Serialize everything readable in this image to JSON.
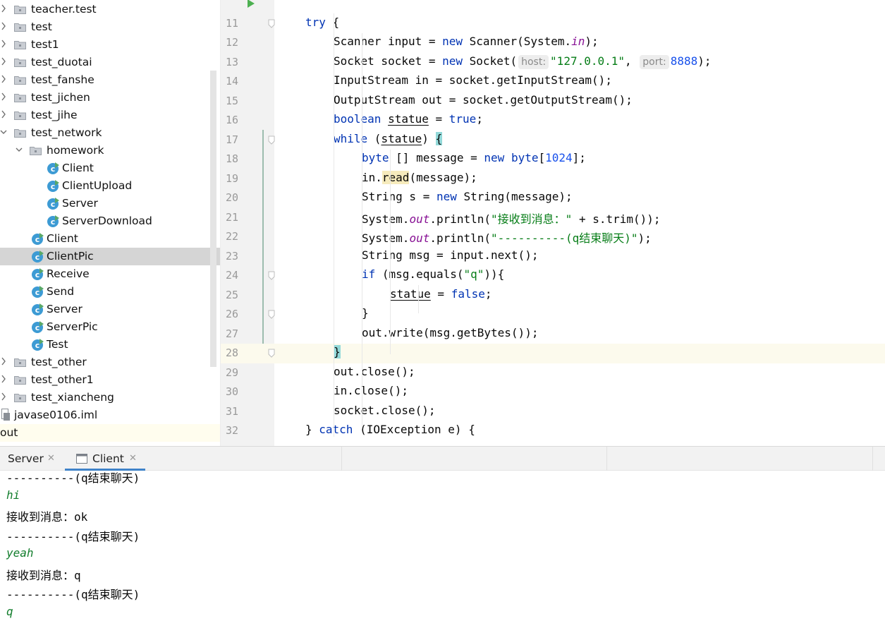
{
  "project_tree": {
    "items": [
      {
        "label": "teacher.test",
        "kind": "folder",
        "arrow": "right"
      },
      {
        "label": "test",
        "kind": "folder",
        "arrow": "right"
      },
      {
        "label": "test1",
        "kind": "folder",
        "arrow": "right"
      },
      {
        "label": "test_duotai",
        "kind": "folder",
        "arrow": "right"
      },
      {
        "label": "test_fanshe",
        "kind": "folder",
        "arrow": "right"
      },
      {
        "label": "test_jichen",
        "kind": "folder",
        "arrow": "right"
      },
      {
        "label": "test_jihe",
        "kind": "folder",
        "arrow": "right"
      },
      {
        "label": "test_network",
        "kind": "folder",
        "arrow": "down"
      },
      {
        "label": "homework",
        "kind": "folder",
        "arrow": "down"
      },
      {
        "label": "Client",
        "kind": "class"
      },
      {
        "label": "ClientUpload",
        "kind": "class"
      },
      {
        "label": "Server",
        "kind": "class"
      },
      {
        "label": "ServerDownload",
        "kind": "class"
      },
      {
        "label": "Client",
        "kind": "class"
      },
      {
        "label": "ClientPic",
        "kind": "class",
        "selected": true
      },
      {
        "label": "Receive",
        "kind": "class"
      },
      {
        "label": "Send",
        "kind": "class"
      },
      {
        "label": "Server",
        "kind": "class"
      },
      {
        "label": "ServerPic",
        "kind": "class"
      },
      {
        "label": "Test",
        "kind": "class"
      },
      {
        "label": "test_other",
        "kind": "folder",
        "arrow": "right"
      },
      {
        "label": "test_other1",
        "kind": "folder",
        "arrow": "right"
      },
      {
        "label": "test_xiancheng",
        "kind": "folder",
        "arrow": "right"
      },
      {
        "label": "javase0106.iml",
        "kind": "file"
      },
      {
        "label": "out",
        "kind": "text",
        "highlight": true
      }
    ]
  },
  "editor": {
    "current_line": 28,
    "lines": [
      {
        "n": "11",
        "segs": [
          {
            "t": "try",
            "c": "kw"
          },
          {
            "t": " {"
          }
        ]
      },
      {
        "n": "12",
        "segs": [
          {
            "t": "Scanner input = "
          },
          {
            "t": "new",
            "c": "kw"
          },
          {
            "t": " Scanner(System."
          },
          {
            "t": "in",
            "c": "fld"
          },
          {
            "t": ");"
          }
        ]
      },
      {
        "n": "13",
        "segs": [
          {
            "t": "Socket socket = "
          },
          {
            "t": "new",
            "c": "kw"
          },
          {
            "t": " Socket("
          },
          {
            "t": "host:",
            "c": "hint"
          },
          {
            "t": "\"127.0.0.1\"",
            "c": "str"
          },
          {
            "t": ", "
          },
          {
            "t": "port:",
            "c": "hint"
          },
          {
            "t": "8888",
            "c": "num"
          },
          {
            "t": ");"
          }
        ]
      },
      {
        "n": "14",
        "segs": [
          {
            "t": "InputStream in = socket.getInputStream();"
          }
        ]
      },
      {
        "n": "15",
        "segs": [
          {
            "t": "OutputStream out = socket.getOutputStream();"
          }
        ]
      },
      {
        "n": "16",
        "segs": [
          {
            "t": "boolean",
            "c": "kw"
          },
          {
            "t": " "
          },
          {
            "t": "statue",
            "c": "ul"
          },
          {
            "t": " = "
          },
          {
            "t": "true",
            "c": "kw"
          },
          {
            "t": ";"
          }
        ]
      },
      {
        "n": "17",
        "segs": [
          {
            "t": "while",
            "c": "kw"
          },
          {
            "t": " ("
          },
          {
            "t": "statue",
            "c": "ul"
          },
          {
            "t": ") "
          },
          {
            "t": "{",
            "c": "brace"
          }
        ]
      },
      {
        "n": "18",
        "segs": [
          {
            "t": "byte",
            "c": "kw"
          },
          {
            "t": " [] message = "
          },
          {
            "t": "new",
            "c": "kw"
          },
          {
            "t": " "
          },
          {
            "t": "byte",
            "c": "kw"
          },
          {
            "t": "["
          },
          {
            "t": "1024",
            "c": "num"
          },
          {
            "t": "];"
          }
        ]
      },
      {
        "n": "19",
        "segs": [
          {
            "t": "in."
          },
          {
            "t": "read",
            "c": "rd"
          },
          {
            "t": "(message);"
          }
        ]
      },
      {
        "n": "20",
        "segs": [
          {
            "t": "String s = "
          },
          {
            "t": "new",
            "c": "kw"
          },
          {
            "t": " String(message);"
          }
        ]
      },
      {
        "n": "21",
        "segs": [
          {
            "t": "System."
          },
          {
            "t": "out",
            "c": "fld"
          },
          {
            "t": ".println("
          },
          {
            "t": "\"接收到消息：\"",
            "c": "str"
          },
          {
            "t": " + s.trim());"
          }
        ]
      },
      {
        "n": "22",
        "segs": [
          {
            "t": "System."
          },
          {
            "t": "out",
            "c": "fld"
          },
          {
            "t": ".println("
          },
          {
            "t": "\"----------(q结束聊天)\"",
            "c": "str"
          },
          {
            "t": ");"
          }
        ]
      },
      {
        "n": "23",
        "segs": [
          {
            "t": "String msg = input.next();"
          }
        ]
      },
      {
        "n": "24",
        "segs": [
          {
            "t": "if",
            "c": "kw"
          },
          {
            "t": " (msg.equals("
          },
          {
            "t": "\"q\"",
            "c": "str"
          },
          {
            "t": ")){"
          }
        ]
      },
      {
        "n": "25",
        "segs": [
          {
            "t": "statue",
            "c": "ul"
          },
          {
            "t": " = "
          },
          {
            "t": "false",
            "c": "kw"
          },
          {
            "t": ";"
          }
        ]
      },
      {
        "n": "26",
        "segs": [
          {
            "t": "}"
          }
        ]
      },
      {
        "n": "27",
        "segs": [
          {
            "t": "out.write(msg.getBytes());"
          }
        ]
      },
      {
        "n": "28",
        "segs": [
          {
            "t": "}",
            "c": "brace"
          }
        ]
      },
      {
        "n": "29",
        "segs": [
          {
            "t": "out.close();"
          }
        ]
      },
      {
        "n": "30",
        "segs": [
          {
            "t": "in.close();"
          }
        ]
      },
      {
        "n": "31",
        "segs": [
          {
            "t": "socket.close();"
          }
        ]
      },
      {
        "n": "32",
        "segs": [
          {
            "t": "} "
          },
          {
            "t": "catch",
            "c": "kw"
          },
          {
            "t": " (IOException e) {"
          }
        ]
      }
    ]
  },
  "run_panel": {
    "tabs": [
      {
        "label": "Server",
        "active": false
      },
      {
        "label": "Client",
        "active": true
      }
    ],
    "console": [
      {
        "text": "----------(q结束聊天)",
        "input": false
      },
      {
        "text": "hi",
        "input": true
      },
      {
        "text": "接收到消息：ok",
        "input": false
      },
      {
        "text": "----------(q结束聊天)",
        "input": false
      },
      {
        "text": "yeah",
        "input": true
      },
      {
        "text": "接收到消息：q",
        "input": false
      },
      {
        "text": "----------(q结束聊天)",
        "input": false
      },
      {
        "text": "q",
        "input": true
      }
    ]
  },
  "icon_names": {
    "collapsed": "chevron-right-icon",
    "expanded": "chevron-down-icon",
    "folder": "package-folder-icon",
    "class": "java-class-icon",
    "file": "module-file-icon",
    "tab": "console-tab-icon",
    "close": "close-icon"
  }
}
